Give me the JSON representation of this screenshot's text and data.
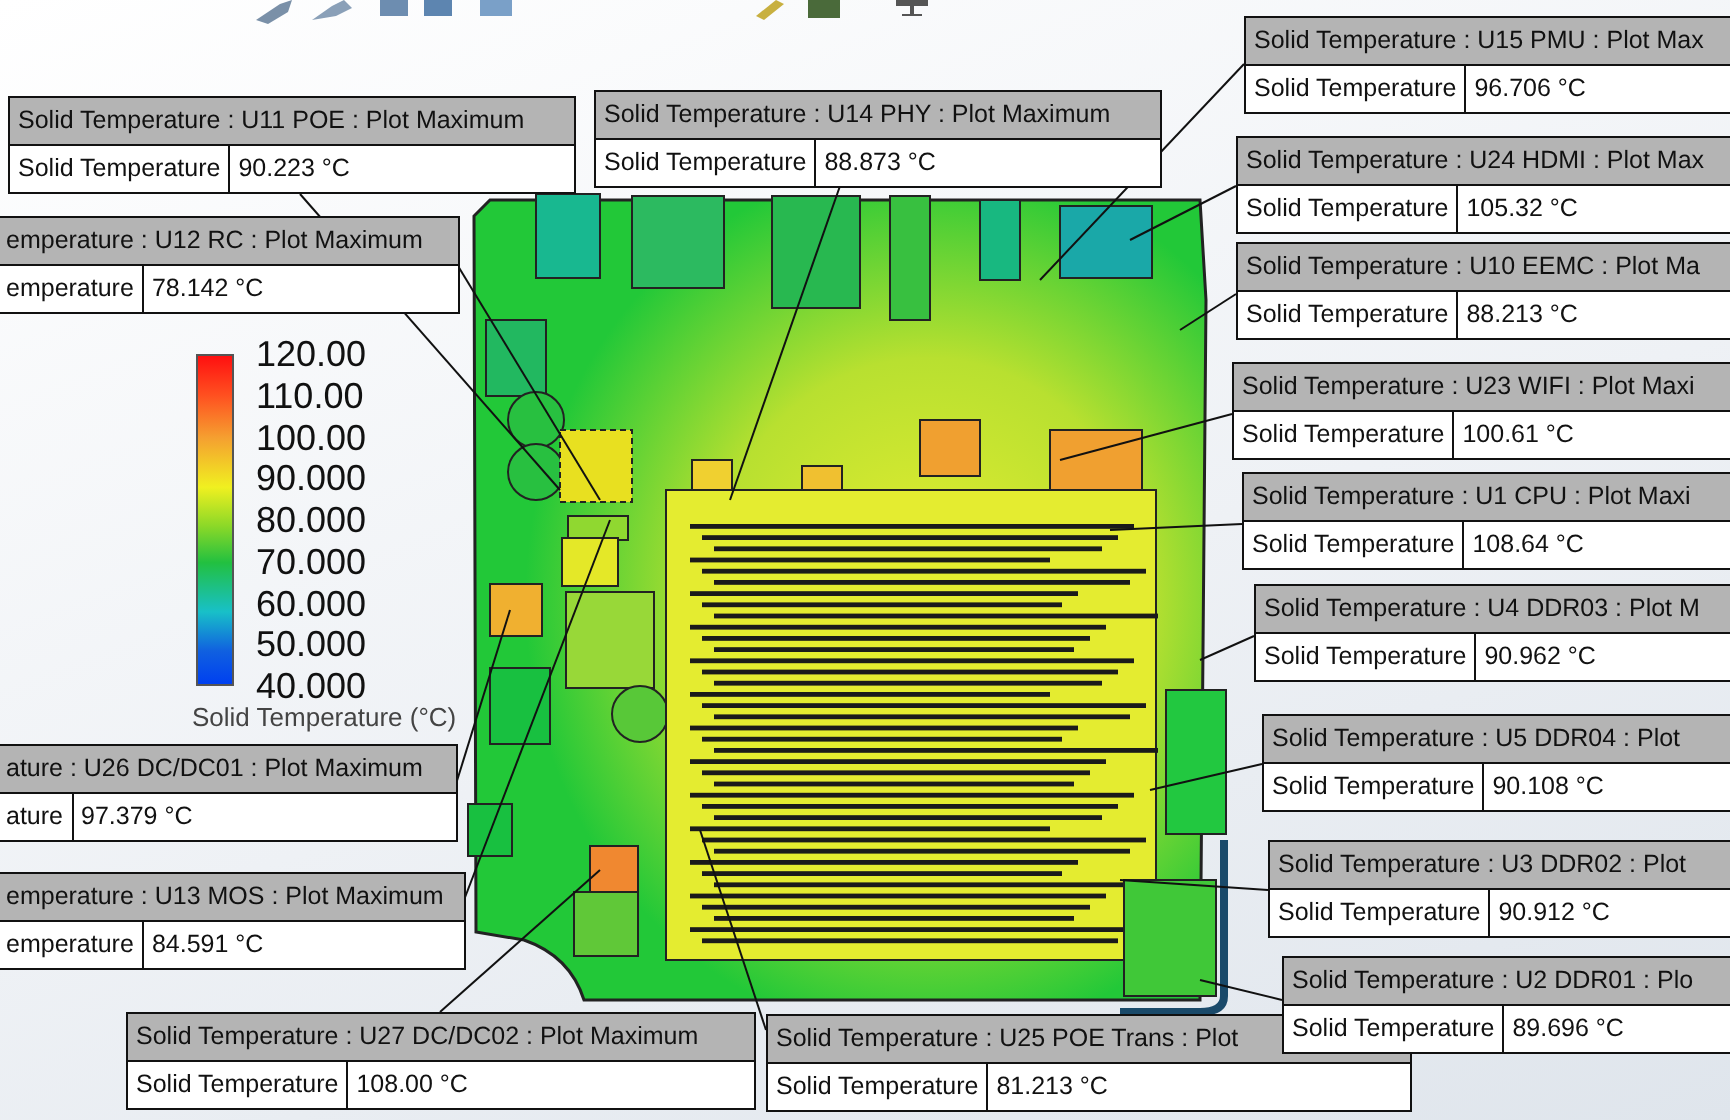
{
  "legend": {
    "ticks": [
      "120.00",
      "110.00",
      "100.00",
      "90.000",
      "80.000",
      "70.000",
      "60.000",
      "50.000",
      "40.000"
    ],
    "title": "Solid Temperature (°C)"
  },
  "probes": [
    {
      "title": "Solid Temperature : U11 POE : Plot Maximum",
      "label": "Solid Temperature",
      "value": "90.223 °C"
    },
    {
      "title": "emperature : U12 RC : Plot Maximum",
      "label": "emperature",
      "value": "78.142 °C"
    },
    {
      "title": "Solid Temperature : U14 PHY : Plot Maximum",
      "label": "Solid Temperature",
      "value": "88.873 °C"
    },
    {
      "title": "Solid Temperature : U15 PMU : Plot Max",
      "label": "Solid Temperature",
      "value": "96.706 °C"
    },
    {
      "title": "Solid Temperature : U24 HDMI : Plot Max",
      "label": "Solid Temperature",
      "value": "105.32 °C"
    },
    {
      "title": "Solid Temperature : U10 EEMC : Plot Ma",
      "label": "Solid Temperature",
      "value": "88.213 °C"
    },
    {
      "title": "Solid Temperature : U23 WIFI : Plot Maxi",
      "label": "Solid Temperature",
      "value": "100.61 °C"
    },
    {
      "title": "Solid Temperature : U1 CPU : Plot Maxi",
      "label": "Solid Temperature",
      "value": "108.64 °C"
    },
    {
      "title": "Solid Temperature : U4 DDR03 : Plot M",
      "label": "Solid Temperature",
      "value": "90.962 °C"
    },
    {
      "title": "Solid Temperature : U5 DDR04 : Plot",
      "label": "Solid Temperature",
      "value": "90.108 °C"
    },
    {
      "title": "Solid Temperature : U3 DDR02 : Plot",
      "label": "Solid Temperature",
      "value": "90.912 °C"
    },
    {
      "title": "Solid Temperature : U2 DDR01 : Plo",
      "label": "Solid Temperature",
      "value": "89.696 °C"
    },
    {
      "title": "ature : U26 DC/DC01 : Plot Maximum",
      "label": "ature",
      "value": "97.379 °C"
    },
    {
      "title": "emperature : U13 MOS : Plot Maximum",
      "label": "emperature",
      "value": "84.591 °C"
    },
    {
      "title": "Solid Temperature : U27 DC/DC02 : Plot Maximum",
      "label": "Solid Temperature",
      "value": "108.00 °C"
    },
    {
      "title": "Solid Temperature : U25 POE Trans : Plot",
      "label": "Solid Temperature",
      "value": "81.213 °C"
    }
  ]
}
